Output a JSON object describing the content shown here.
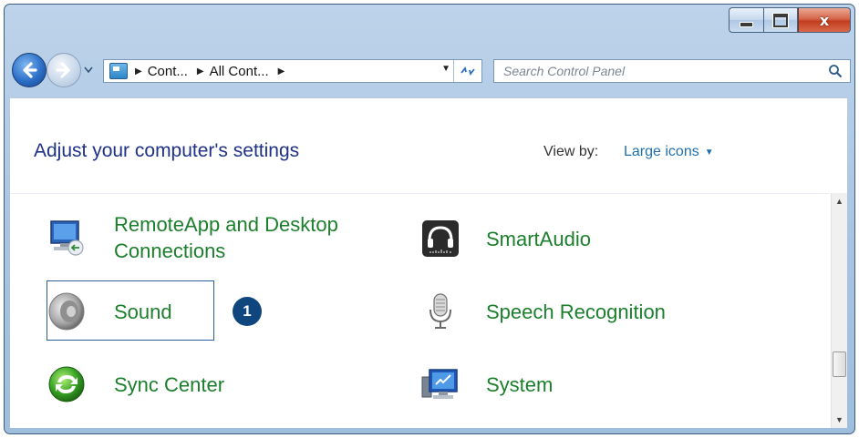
{
  "window": {
    "caption": {
      "minimize": "",
      "maximize": "",
      "close": "x"
    }
  },
  "navbar": {
    "breadcrumbs": [
      {
        "label": "Cont..."
      },
      {
        "label": "All Cont..."
      }
    ],
    "search_placeholder": "Search Control Panel"
  },
  "content": {
    "heading": "Adjust your computer's settings",
    "view_by_label": "View by:",
    "view_by_value": "Large icons"
  },
  "items": {
    "remoteapp": {
      "line1": "RemoteApp and Desktop",
      "line2": "Connections",
      "icon": "remote-desktop-icon"
    },
    "smartaudio": {
      "label": "SmartAudio",
      "icon": "headphones-icon"
    },
    "sound": {
      "label": "Sound",
      "icon": "speaker-icon"
    },
    "speech": {
      "label": "Speech Recognition",
      "icon": "microphone-icon"
    },
    "sync": {
      "label": "Sync Center",
      "icon": "sync-icon"
    },
    "system": {
      "label": "System",
      "icon": "computer-icon"
    }
  },
  "callout": {
    "number": "1"
  },
  "colors": {
    "heading": "#1e3287",
    "item_text": "#1b7f2c",
    "callout_bg": "#10467e",
    "link": "#1f6fb0"
  }
}
